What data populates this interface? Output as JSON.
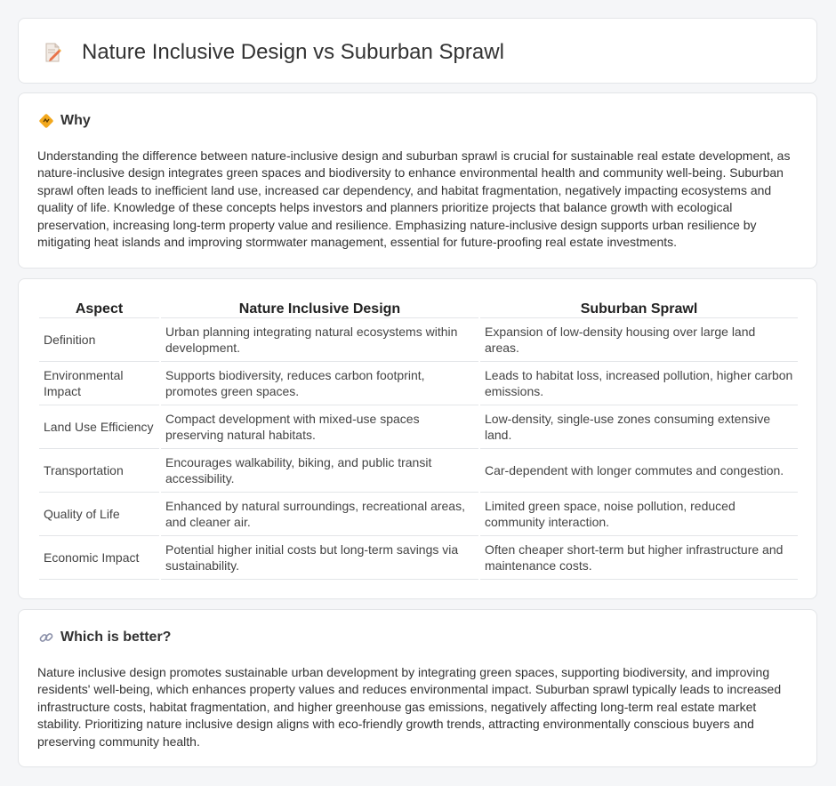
{
  "page": {
    "title": "Nature Inclusive Design vs Suburban Sprawl",
    "title_icon": "document-edit-icon"
  },
  "why": {
    "heading": "Why",
    "icon": "diamond-sign-icon",
    "text": "Understanding the difference between nature-inclusive design and suburban sprawl is crucial for sustainable real estate development, as nature-inclusive design integrates green spaces and biodiversity to enhance environmental health and community well-being. Suburban sprawl often leads to inefficient land use, increased car dependency, and habitat fragmentation, negatively impacting ecosystems and quality of life. Knowledge of these concepts helps investors and planners prioritize projects that balance growth with ecological preservation, increasing long-term property value and resilience. Emphasizing nature-inclusive design supports urban resilience by mitigating heat islands and improving stormwater management, essential for future-proofing real estate investments."
  },
  "table": {
    "headers": [
      "Aspect",
      "Nature Inclusive Design",
      "Suburban Sprawl"
    ],
    "rows": [
      [
        "Definition",
        "Urban planning integrating natural ecosystems within development.",
        "Expansion of low-density housing over large land areas."
      ],
      [
        "Environmental Impact",
        "Supports biodiversity, reduces carbon footprint, promotes green spaces.",
        "Leads to habitat loss, increased pollution, higher carbon emissions."
      ],
      [
        "Land Use Efficiency",
        "Compact development with mixed-use spaces preserving natural habitats.",
        "Low-density, single-use zones consuming extensive land."
      ],
      [
        "Transportation",
        "Encourages walkability, biking, and public transit accessibility.",
        "Car-dependent with longer commutes and congestion."
      ],
      [
        "Quality of Life",
        "Enhanced by natural surroundings, recreational areas, and cleaner air.",
        "Limited green space, noise pollution, reduced community interaction."
      ],
      [
        "Economic Impact",
        "Potential higher initial costs but long-term savings via sustainability.",
        "Often cheaper short-term but higher infrastructure and maintenance costs."
      ]
    ]
  },
  "better": {
    "heading": "Which is better?",
    "icon": "link-icon",
    "text": "Nature inclusive design promotes sustainable urban development by integrating green spaces, supporting biodiversity, and improving residents' well-being, which enhances property values and reduces environmental impact. Suburban sprawl typically leads to increased infrastructure costs, habitat fragmentation, and higher greenhouse gas emissions, negatively affecting long-term real estate market stability. Prioritizing nature inclusive design aligns with eco-friendly growth trends, attracting environmentally conscious buyers and preserving community health."
  }
}
